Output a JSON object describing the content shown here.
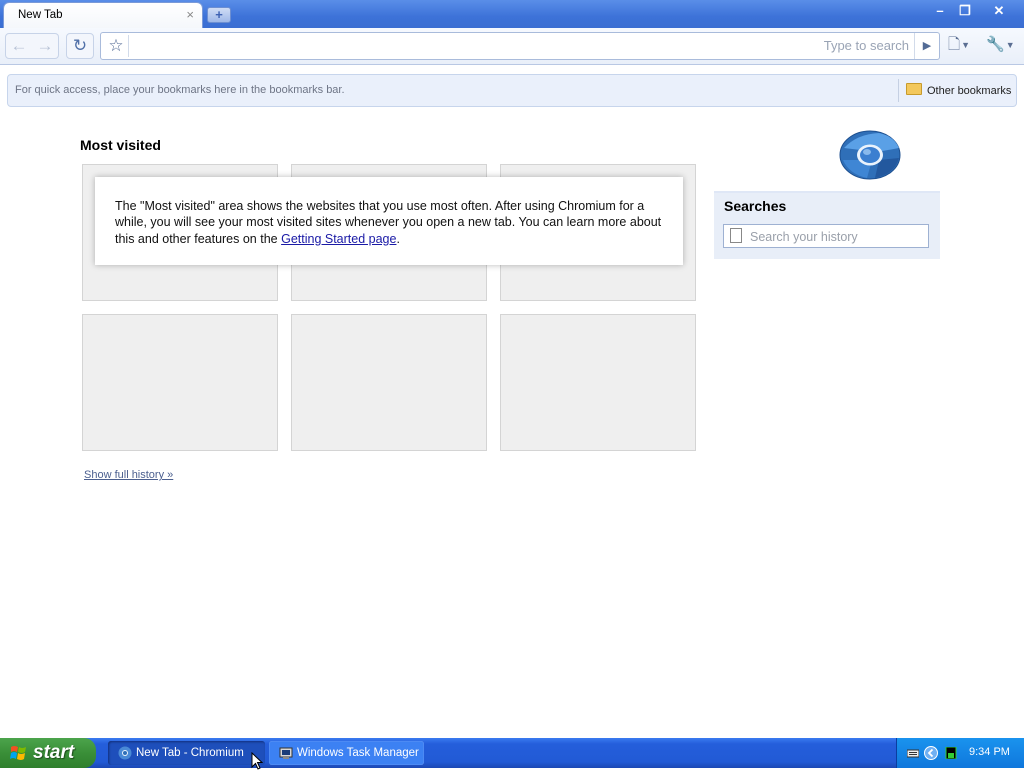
{
  "window": {
    "tab_title": "New Tab",
    "tab_close": "×",
    "new_tab_symbol": "+",
    "controls": {
      "minimize": "–",
      "maximize": "❐",
      "close": "✕"
    }
  },
  "toolbar": {
    "back_symbol": "←",
    "forward_symbol": "→",
    "reload_symbol": "↻",
    "star_symbol": "☆",
    "omnibox_value": "",
    "omnibox_hint": "Type to search",
    "go_symbol": "▶",
    "page_menu_symbol": "🗋",
    "wrench_symbol": "🔧"
  },
  "bookmarks": {
    "hint": "For quick access, place your bookmarks here in the bookmarks bar.",
    "other": "Other bookmarks"
  },
  "ntp": {
    "most_visited_title": "Most visited",
    "notice_text_before": "The \"Most visited\" area shows the websites that you use most often. After using Chromium for a while, you will see your most visited sites whenever you open a new tab. You can learn more about this and other features on the ",
    "notice_link": "Getting Started page",
    "notice_text_after": ".",
    "show_full_history": "Show full history »",
    "searches_title": "Searches",
    "search_placeholder": "Search your history"
  },
  "taskbar": {
    "start_label": "start",
    "tasks": [
      {
        "label": "New Tab - Chromium"
      },
      {
        "label": "Windows Task Manager"
      }
    ],
    "clock": "9:34 PM"
  },
  "colors": {
    "titlebar": "#3d72d8",
    "taskbar": "#245edb",
    "start_green": "#3a8f38",
    "link": "#1a1aa6"
  }
}
